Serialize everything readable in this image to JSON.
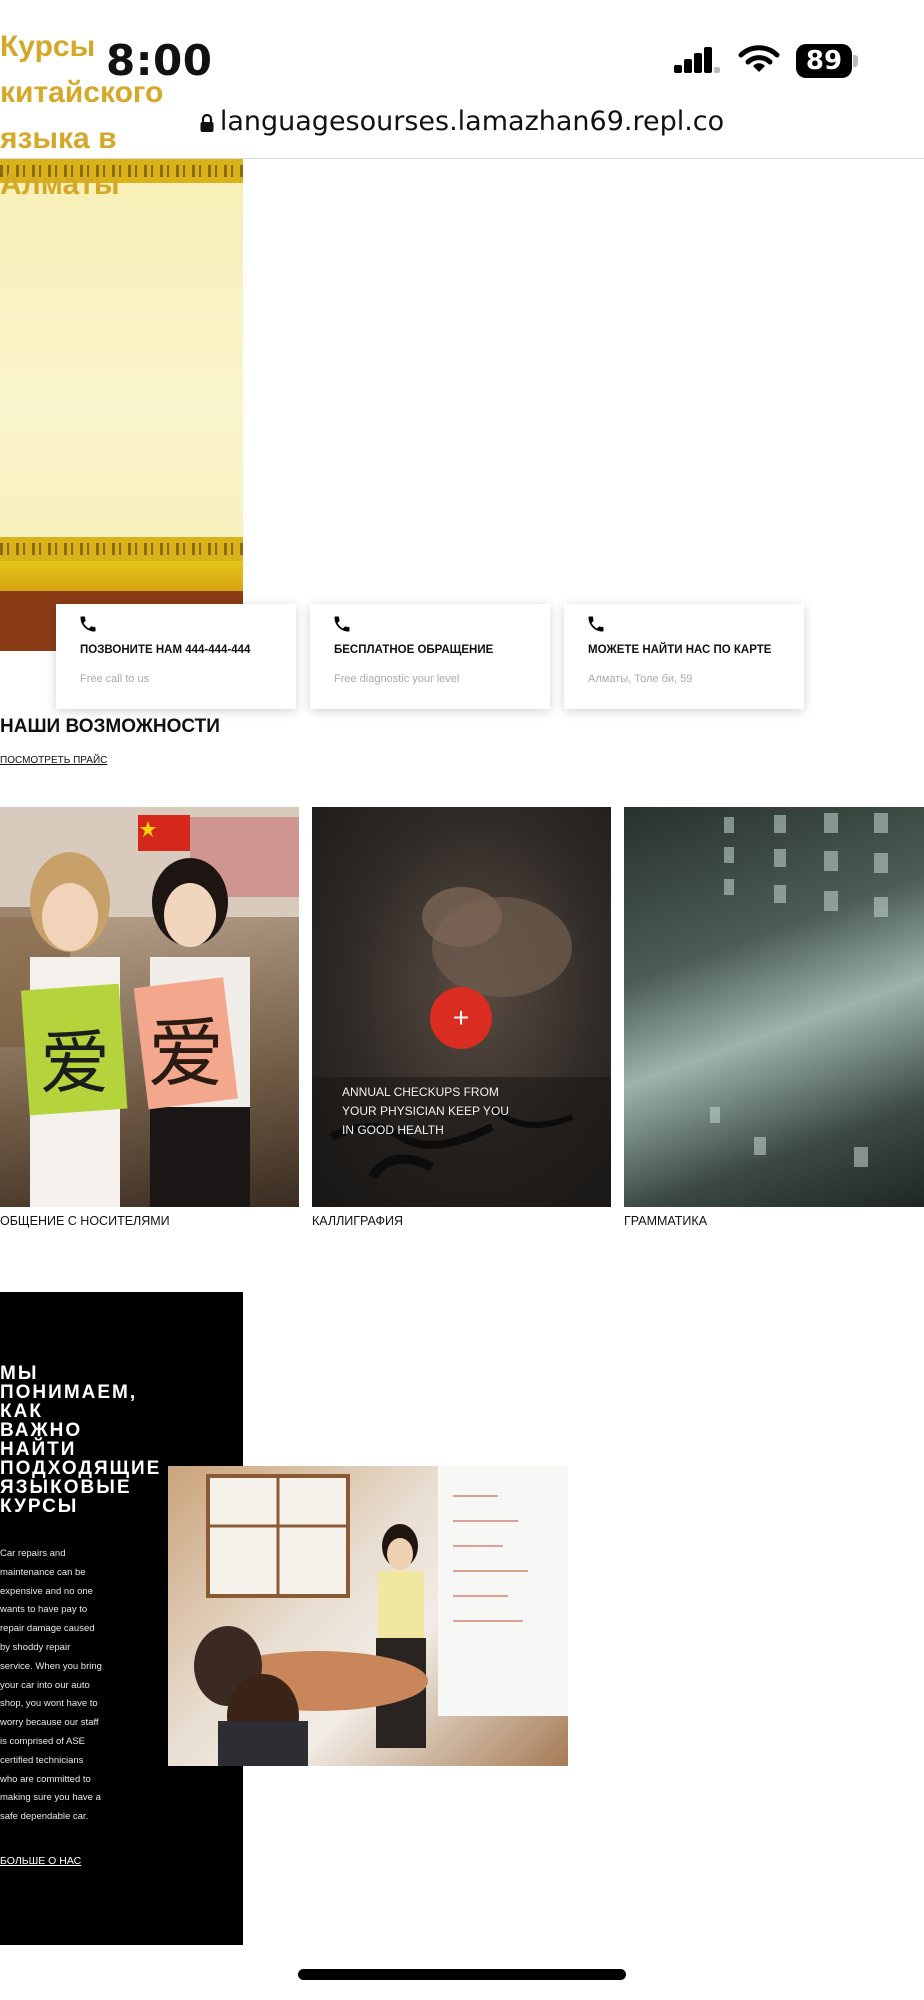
{
  "status_bar": {
    "time": "8:00",
    "battery": "89",
    "icons": [
      "cellular-signal-icon",
      "wifi-icon",
      "battery-icon"
    ]
  },
  "browser": {
    "url": "languagesourses.lamazhan69.repl.co",
    "lock_icon": "lock-icon"
  },
  "hero": {
    "title_lines": [
      "Курсы",
      "китайского",
      "языка в",
      "Алматы"
    ]
  },
  "info_cards": [
    {
      "icon": "phone-icon",
      "title": "ПОЗВОНИТЕ НАМ 444-444-444",
      "subtitle": "Free call to us"
    },
    {
      "icon": "phone-icon",
      "title": "БЕСПЛАТНОЕ ОБРАЩЕНИЕ",
      "subtitle": "Free diagnostic your level"
    },
    {
      "icon": "phone-icon",
      "title": "МОЖЕТЕ НАЙТИ НАС ПО КАРТЕ",
      "subtitle": "Алматы, Толе би, 59"
    }
  ],
  "capabilities": {
    "title": "НАШИ ВОЗМОЖНОСТИ",
    "price_link": "ПОСМОТРЕТЬ ПРАЙС",
    "tiles": [
      {
        "label": "ОБЩЕНИЕ С НОСИТЕЛЯМИ"
      },
      {
        "label": "КАЛЛИГРАФИЯ",
        "button": "+",
        "caption": "ANNUAL CHECKUPS FROM YOUR PHYSICIAN KEEP YOU IN GOOD HEALTH"
      },
      {
        "label": "ГРАММАТИКА"
      }
    ],
    "calligraphy_chars": [
      "爱",
      "爱"
    ]
  },
  "about": {
    "title_lines": [
      "МЫ",
      "ПОНИМАЕМ,",
      "КАК",
      "ВАЖНО",
      "НАЙТИ",
      "ПОДХОДЯЩИЕ",
      "ЯЗЫКОВЫЕ",
      "КУРСЫ"
    ],
    "text_lines": [
      "Car repairs and",
      "maintenance can be",
      "expensive and no one",
      "wants to have pay to",
      "repair damage caused",
      "by shoddy repair",
      "service. When you bring",
      "your car into our auto",
      "shop, you wont have to",
      "worry because our staff",
      "is comprised of ASE",
      "certified technicians",
      "who are committed to",
      "making sure you have a",
      "safe dependable car."
    ],
    "link": "БОЛЬШЕ О НАС"
  },
  "colors": {
    "hero_title": "#d6a829",
    "plus_button": "#d92d21",
    "about_bg": "#000000"
  }
}
